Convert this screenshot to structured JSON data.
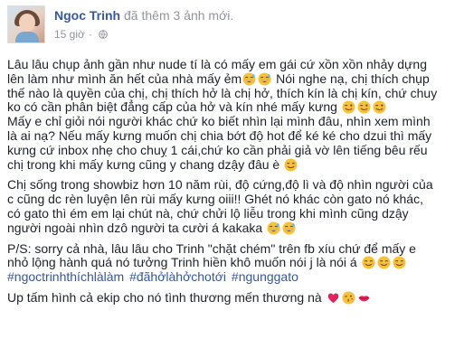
{
  "author": {
    "name": "Ngoc Trinh",
    "action": "đã thêm 3 ảnh mới.",
    "timestamp": "15 giờ",
    "separator": "·"
  },
  "icons": {
    "globe": "globe-icon",
    "grin": "grinning-sweat-emoji",
    "wink": "winking-tongue-emoji",
    "smile": "smiling-face-emoji",
    "heart": "red-heart-emoji",
    "kiss": "face-blowing-kiss-emoji",
    "lips": "lips-emoji"
  },
  "colors": {
    "link": "#365899",
    "muted": "#90949c",
    "text": "#1d2129"
  },
  "post": {
    "p1": {
      "l1": "Lâu lâu chụp ảnh gần như nude tí là có mấy em gái cứ xồn xồn nhảy dựng",
      "l2": "lên làm như mình ăn hết của nhà mấy ẻm",
      "l2b": " Nói nghe nạ, chị thích chụp",
      "l3": "thế nào là quyền của chị, chị thích hở là chị hở, thích kín là chị kín, chứ chuy",
      "l4": "ko có cần phân biệt đẳng cấp của hở và kín nhé mấy kưng",
      "l5": "Mấy e chỉ giỏi nói người khác chứ ko biết nhìn lại mình đâu, nhìn xem mình",
      "l6": "là ai nạ? Nếu mấy kưng muốn chị chia bớt độ hot để ké ké cho dzui thì mấy",
      "l7": "kưng cứ inbox nhẹ cho chuỵ 1 cái,chứ ko cần phải giả vờ lên tiếng bêu rếu",
      "l8": "chị trong khi mấy kưng cũng y chang dzậy đâu è"
    },
    "p2": {
      "l1": "Chị sống trong showbiz hơn 10 năm rùi, độ cứng,độ lì và độ nhìn người của",
      "l2": "c cũng dc rèn luyện lên rùi mấy kưng oiii!! Ghét nó khác còn gato nó khác,",
      "l3": "có gato thì ém em lại chút nà, chứ chửi lộ liễu trong khi mình cũng dzậy",
      "l4": "người ngoài nhìn dzô người ta cười á kakaka"
    },
    "p3": {
      "l1": "P/S: sorry cả nhà, lâu lâu cho Trinh \"chặt chém\" trên fb xíu chứ để mấy e",
      "l2": "nhỏ lộng hành quá nó tưởng Trinh hiền khô muốn nói j là nói á",
      "hashtags": [
        "#ngoctrinhthíchlàlàm",
        "#đãhởlàhởchotới",
        "#ngunggato"
      ]
    },
    "p4": {
      "l1": "Up tấm hình cả ekip cho nó tình thương mến thương nà"
    }
  }
}
